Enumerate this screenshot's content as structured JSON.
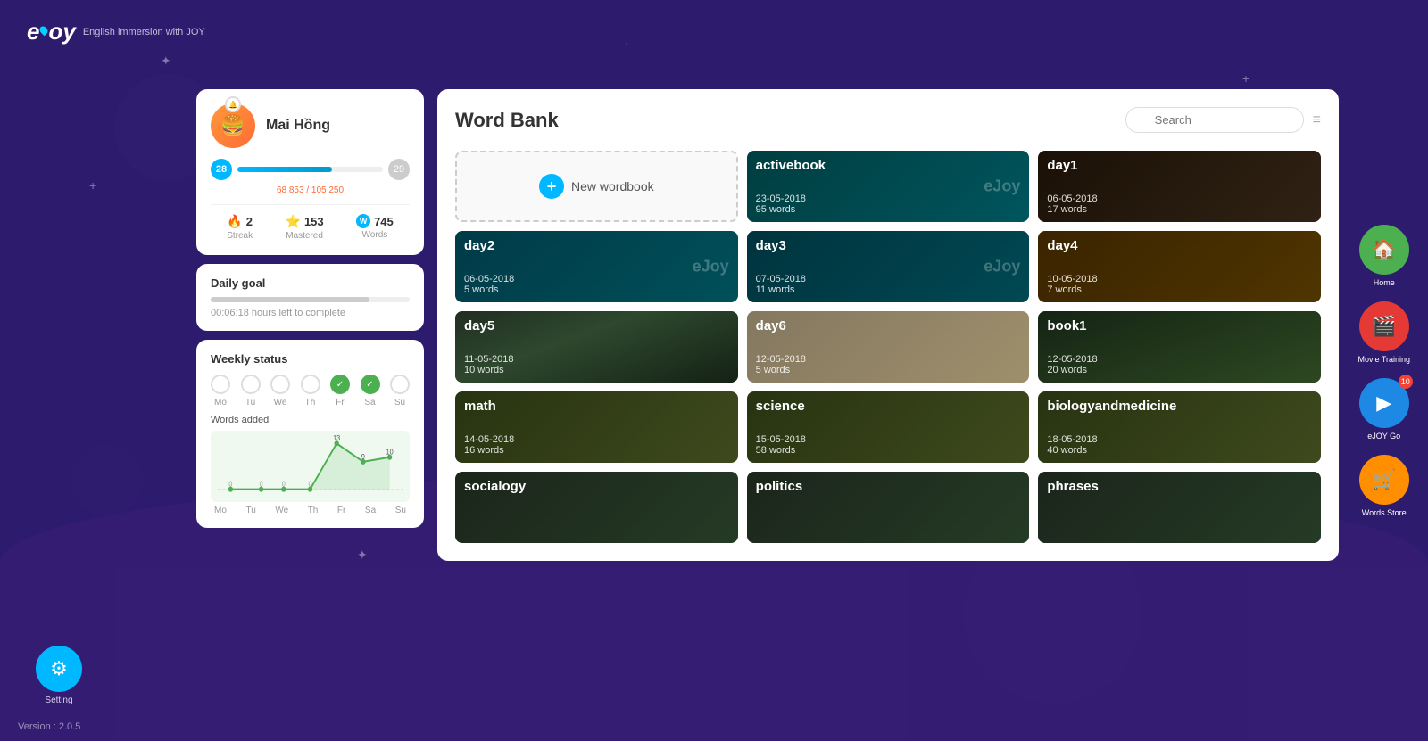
{
  "app": {
    "name": "eJOY",
    "subtitle": "English immersion with JOY",
    "version": "Version : 2.0.5"
  },
  "profile": {
    "username": "Mai Hồng",
    "level_current": 28,
    "level_next": 29,
    "xp_current": "68 853",
    "xp_total": "105 250",
    "streak": 2,
    "streak_label": "Streak",
    "mastered": 153,
    "mastered_label": "Mastered",
    "words": 745,
    "words_label": "Words",
    "level_bar_pct": 65
  },
  "daily_goal": {
    "title": "Daily goal",
    "time_left": "00:06:18 hours left to complete"
  },
  "weekly_status": {
    "title": "Weekly status",
    "days": [
      "Mo",
      "Tu",
      "We",
      "Th",
      "Fr",
      "Sa",
      "Su"
    ],
    "done": [
      false,
      false,
      false,
      false,
      true,
      true,
      false
    ],
    "words_added_label": "Words added",
    "chart_values": [
      0,
      0,
      0,
      0,
      13,
      9,
      10
    ],
    "chart_zero_days": [
      "Mo",
      "Tu",
      "We",
      "Th"
    ],
    "chart_days_all": [
      "Mo",
      "Tu",
      "We",
      "Th",
      "Fr",
      "Sa",
      "Su"
    ]
  },
  "word_bank": {
    "title": "Word Bank",
    "search_placeholder": "Search",
    "new_wordbook_label": "New wordbook",
    "books": [
      {
        "id": "new",
        "type": "new"
      },
      {
        "id": "activebook",
        "name": "activebook",
        "date": "23-05-2018",
        "words": "95 words",
        "color": "teal",
        "ejoy": true
      },
      {
        "id": "day1",
        "name": "day1",
        "date": "06-05-2018",
        "words": "17 words",
        "color": "dark-photo"
      },
      {
        "id": "day2",
        "name": "day2",
        "date": "06-05-2018",
        "words": "5 words",
        "color": "teal2",
        "ejoy": true
      },
      {
        "id": "day3",
        "name": "day3",
        "date": "07-05-2018",
        "words": "11 words",
        "color": "teal3",
        "ejoy": true
      },
      {
        "id": "day4",
        "name": "day4",
        "date": "10-05-2018",
        "words": "7 words",
        "color": "orange"
      },
      {
        "id": "day5",
        "name": "day5",
        "date": "11-05-2018",
        "words": "10 words",
        "color": "road"
      },
      {
        "id": "day6",
        "name": "day6",
        "date": "12-05-2018",
        "words": "5 words",
        "color": "road2"
      },
      {
        "id": "book1",
        "name": "book1",
        "date": "12-05-2018",
        "words": "20 words",
        "color": "road3"
      },
      {
        "id": "math",
        "name": "math",
        "date": "14-05-2018",
        "words": "16 words",
        "color": "road4"
      },
      {
        "id": "science",
        "name": "science",
        "date": "15-05-2018",
        "words": "58 words",
        "color": "road5"
      },
      {
        "id": "biologyandmedicine",
        "name": "biologyandmedicine",
        "date": "18-05-2018",
        "words": "40 words",
        "color": "road6"
      },
      {
        "id": "socialogy",
        "name": "socialogy",
        "date": "",
        "words": "",
        "color": "bottom"
      },
      {
        "id": "politics",
        "name": "politics",
        "date": "",
        "words": "",
        "color": "bottom2"
      },
      {
        "id": "phrases",
        "name": "phrases",
        "date": "",
        "words": "",
        "color": "bottom3"
      }
    ]
  },
  "sidebar": {
    "items": [
      {
        "id": "home",
        "label": "Home",
        "color": "green",
        "icon": "🏠"
      },
      {
        "id": "movie",
        "label": "Movie Training",
        "color": "red",
        "icon": "🎬"
      },
      {
        "id": "go",
        "label": "eJOY Go",
        "color": "blue",
        "icon": "▶",
        "badge": 10
      },
      {
        "id": "store",
        "label": "Words Store",
        "color": "orange",
        "icon": "🛒"
      }
    ]
  },
  "settings": {
    "label": "Setting",
    "icon": "⚙"
  }
}
